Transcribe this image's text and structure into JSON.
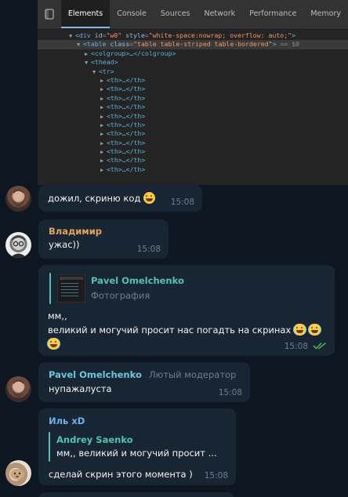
{
  "devtools": {
    "tabs": [
      "Elements",
      "Console",
      "Sources",
      "Network",
      "Performance",
      "Memory"
    ],
    "active_tab": "Elements",
    "lines": {
      "l1": {
        "tag_open": "<div",
        "attr1": "id",
        "val1": "\"w0\"",
        "attr2": "style",
        "val2": "\"white-space:nowrap; overflow: auto;\"",
        "close": ">"
      },
      "l2": {
        "tag_open": "<table",
        "attr1": "class",
        "val1": "\"table table-striped table-bordered\"",
        "close": ">",
        "marker": "== $0"
      },
      "l3": {
        "text": "<colgroup>…</colgroup>"
      },
      "l4": {
        "text": "<thead>"
      },
      "l5": {
        "text": "<tr>"
      },
      "th_row": "<th>…</th>",
      "th_count": 11
    }
  },
  "messages": [
    {
      "id": "m1",
      "text": "дожил, скриню код",
      "time": "15:08",
      "emoji": "grinning-face"
    },
    {
      "id": "m2",
      "sender": "Владимир",
      "text": "ужас))",
      "time": "15:08"
    },
    {
      "id": "m3",
      "reply_name": "Pavel Omelchenko",
      "reply_sub": "Фотография",
      "text1": "мм,,",
      "text2": "великий и могучий просит нас погадть на скринах",
      "time": "15:08",
      "status": "read-double-check"
    },
    {
      "id": "m4",
      "sender": "Pavel Omelchenko",
      "badge": "Лютый модератор",
      "text": "нупажалуста",
      "time": "15:08"
    },
    {
      "id": "m5",
      "sender": "Иль xD",
      "reply_name": "Andrey Saenko",
      "reply_text": "мм,,  великий и могучий просит ...",
      "text": "сделай скрин этого момента )",
      "time": "15:08"
    }
  ],
  "colors": {
    "background": "#0e1621",
    "bubble": "#182533",
    "name_vladimir": "#e7a35a",
    "name_pavel": "#6bc7df",
    "name_il": "#6bb3e9",
    "reply_accent": "#55c2b0",
    "check": "#4fae4e"
  }
}
